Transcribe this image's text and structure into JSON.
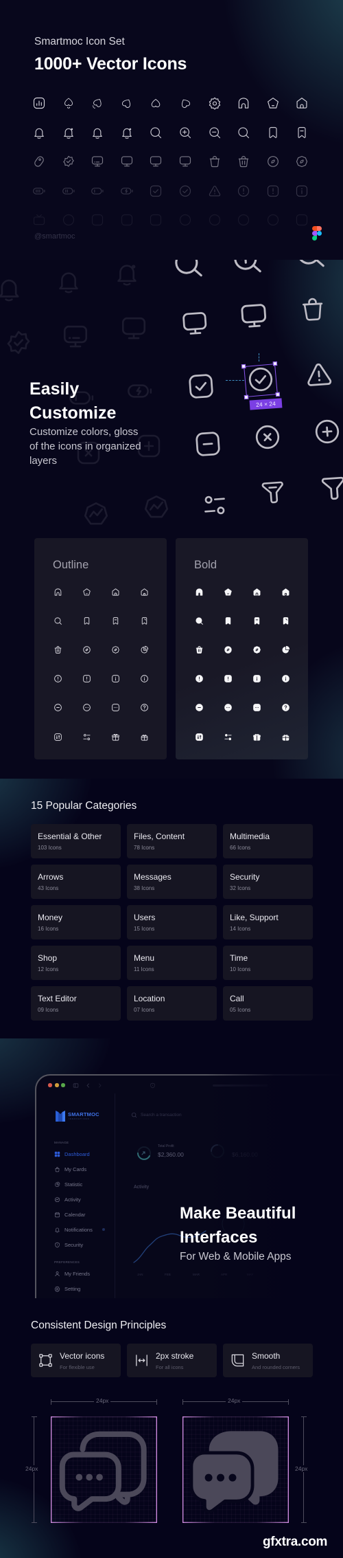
{
  "colors": {
    "selection_purple": "#7b3fe4",
    "brand_blue": "#2d5bd8",
    "teal_glow": "#244f5c",
    "background": "#05041a"
  },
  "hero": {
    "subtitle": "Smartmoc Icon Set",
    "title": "1000+ Vector Icons",
    "handle": "@smartmoc",
    "icon_rows": [
      [
        "chart-square",
        "heart-drip",
        "heart-tilt-sparkle",
        "heart-tilt-left",
        "heart-up",
        "heart-tilt-right",
        "gear",
        "home-arch",
        "home-pentagon",
        "home-door"
      ],
      [
        "bell",
        "bell-dot",
        "bell",
        "bell-dot",
        "search",
        "zoom-in",
        "zoom-out",
        "search",
        "bookmark",
        "bookmark-minus"
      ],
      [
        "tag",
        "badge-check",
        "monitor-dots",
        "monitor",
        "monitor",
        "monitor",
        "trash",
        "trash-lines",
        "discount-circle",
        "discount-shape"
      ],
      [
        "battery-full",
        "battery-half",
        "battery-low",
        "battery-charge",
        "check-square",
        "check-circle",
        "warning",
        "alert-circle",
        "alert-square",
        "info-square"
      ],
      [
        "tv",
        "circle-outline",
        "square-outline",
        "square-outline",
        "square-outline",
        "circle-outline",
        "circle-outline",
        "circle-outline",
        "circle-outline",
        "square-outline"
      ]
    ]
  },
  "customize": {
    "title_lines": [
      "Easily",
      "Customize"
    ],
    "description_lines": [
      "Customize colors, gloss",
      "of the icons in organized",
      "layers"
    ],
    "selection_label": "24 × 24",
    "icons": [
      "search",
      "zoom-in",
      "search",
      "monitor",
      "monitor",
      "trash",
      "check-square",
      "check-circle",
      "warning",
      "minus-square",
      "x-circle",
      "plus-circle",
      "sliders",
      "filter-lines",
      "filter"
    ],
    "background_icons": [
      "bell",
      "bell",
      "bell-dot",
      "badge-check",
      "monitor-dots",
      "monitor",
      "battery-charge",
      "battery-low",
      "x-square",
      "plus-square",
      "activity-shape",
      "activity-shape"
    ]
  },
  "styles": {
    "outline_title": "Outline",
    "bold_title": "Bold",
    "icon_rows": [
      [
        "home-arch",
        "home-pentagon",
        "home-door",
        "home-door-alt"
      ],
      [
        "search",
        "bookmark",
        "bookmark-minus",
        "bookmark-edit"
      ],
      [
        "trash-lines",
        "discount-circle",
        "discount-shape",
        "pie-chart"
      ],
      [
        "alert-circle",
        "alert-square",
        "info-square",
        "info-circle"
      ],
      [
        "minus-circle",
        "more-circle",
        "more-square",
        "help-circle"
      ],
      [
        "sort-square",
        "sliders",
        "gift",
        "gift-alt"
      ]
    ]
  },
  "categories": {
    "title": "15 Popular Categories",
    "items": [
      {
        "name": "Essential & Other",
        "count": "103 Icons"
      },
      {
        "name": "Files, Content",
        "count": "78 Icons"
      },
      {
        "name": "Multimedia",
        "count": "66 Icons"
      },
      {
        "name": "Arrows",
        "count": "43 Icons"
      },
      {
        "name": "Messages",
        "count": "38 Icons"
      },
      {
        "name": "Security",
        "count": "32 Icons"
      },
      {
        "name": "Money",
        "count": "16 Icons"
      },
      {
        "name": "Users",
        "count": "15 Icons"
      },
      {
        "name": "Like, Support",
        "count": "14 Icons"
      },
      {
        "name": "Shop",
        "count": "12 Icons"
      },
      {
        "name": "Menu",
        "count": "11 Icons"
      },
      {
        "name": "Time",
        "count": "10 Icons"
      },
      {
        "name": "Text Editor",
        "count": "09 Icons"
      },
      {
        "name": "Location",
        "count": "07 Icons"
      },
      {
        "name": "Call",
        "count": "05 Icons"
      }
    ]
  },
  "interfaces": {
    "title_lines": [
      "Make Beautiful",
      "Interfaces"
    ],
    "subtitle": "For Web & Mobile Apps",
    "mockup": {
      "logo_text": "SMARTMOC",
      "logo_tagline": "INNOVATIONS",
      "search_placeholder": "Search a transaction",
      "sections": [
        {
          "label": "MANAGE",
          "items": [
            {
              "icon": "grid-4",
              "label": "Dashboard",
              "active": true
            },
            {
              "icon": "bag",
              "label": "My Cards"
            },
            {
              "icon": "pie-chart",
              "label": "Statistic"
            },
            {
              "icon": "activity-shape",
              "label": "Activity"
            },
            {
              "icon": "calendar",
              "label": "Calendar"
            },
            {
              "icon": "bell",
              "label": "Notifications",
              "badge": true
            },
            {
              "icon": "shield",
              "label": "Security"
            }
          ]
        },
        {
          "label": "PREFERENCES",
          "items": [
            {
              "icon": "user",
              "label": "My Friends"
            },
            {
              "icon": "gear",
              "label": "Setting"
            }
          ]
        }
      ],
      "stats": [
        {
          "label": "Total Profit",
          "value": "$2,360.00"
        },
        {
          "label": "",
          "value": "$6,160.00"
        }
      ],
      "activity_title": "Activity",
      "chart_months": [
        "JAN",
        "FEB",
        "MAR",
        "APR",
        "MAY"
      ]
    }
  },
  "principles": {
    "title": "Consistent Design Principles",
    "items": [
      {
        "icon": "vector-frame",
        "title": "Vector icons",
        "subtitle": "For flexible use"
      },
      {
        "icon": "stroke-width",
        "title": "2px stroke",
        "subtitle": "For all icons"
      },
      {
        "icon": "rounded-corner",
        "title": "Smooth",
        "subtitle": "And rounded corners"
      }
    ],
    "dimension_label": "24px",
    "diagrams": [
      {
        "style": "outline",
        "icon": "chat-bubbles"
      },
      {
        "style": "bold",
        "icon": "chat-bubbles"
      }
    ]
  },
  "watermark": "gfxtra.com"
}
